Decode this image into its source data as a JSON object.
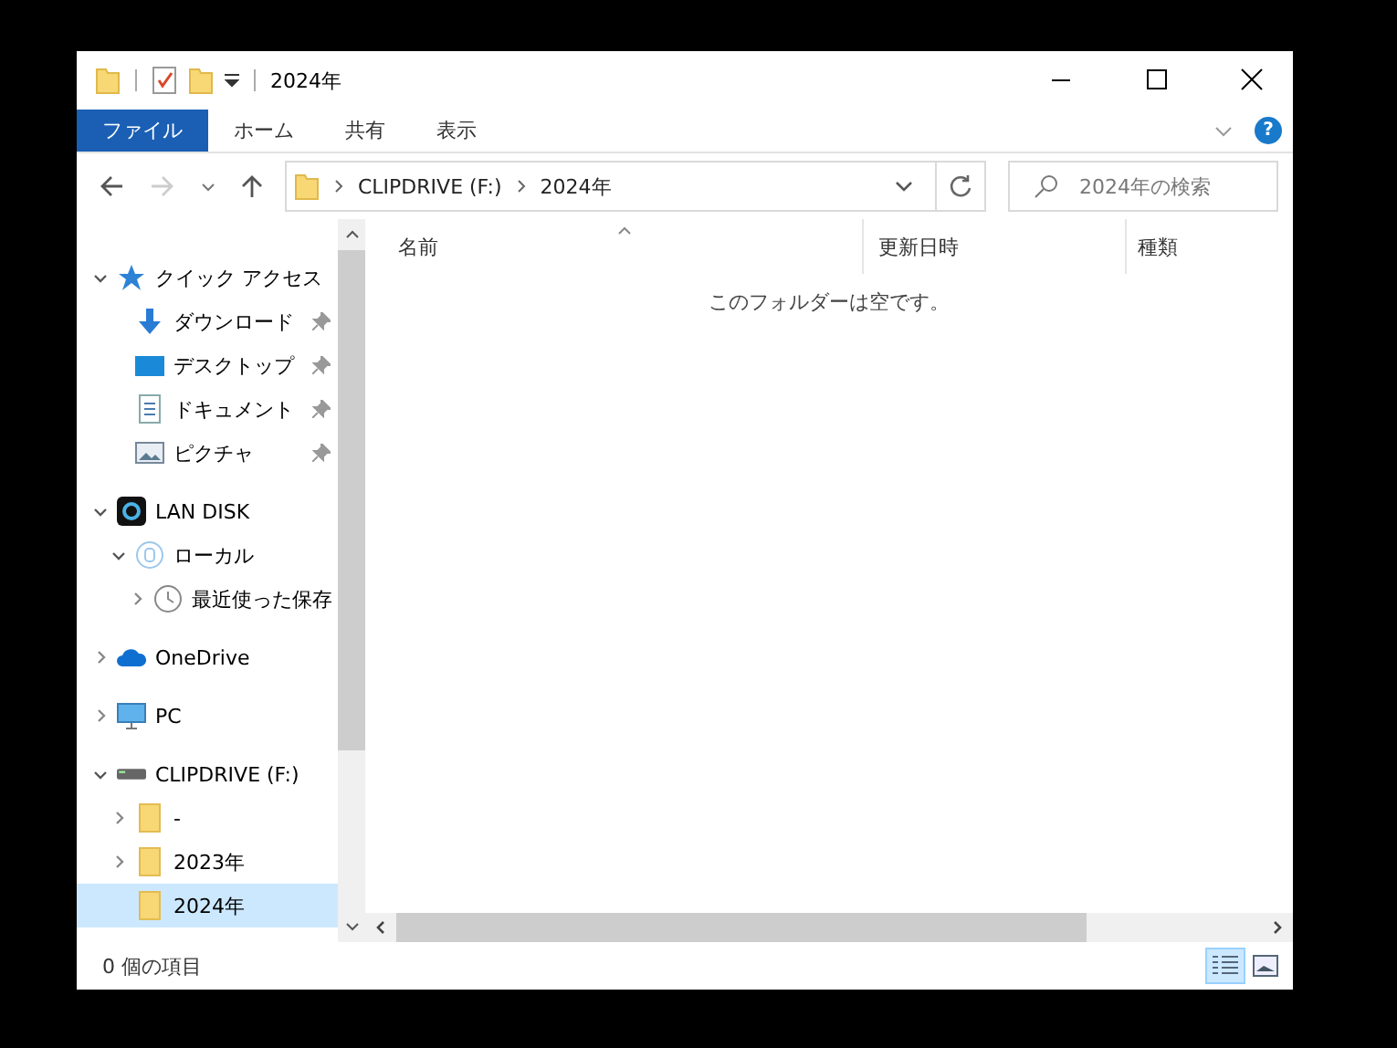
{
  "window": {
    "title": "2024年"
  },
  "ribbon": {
    "tabs": [
      {
        "label": "ファイル",
        "selected": true
      },
      {
        "label": "ホーム",
        "selected": false
      },
      {
        "label": "共有",
        "selected": false
      },
      {
        "label": "表示",
        "selected": false
      }
    ]
  },
  "address": {
    "path": [
      "CLIPDRIVE (F:)",
      "2024年"
    ]
  },
  "search": {
    "placeholder": "2024年の検索"
  },
  "help": {
    "label": "?"
  },
  "sidebar": {
    "items": [
      {
        "label": "クイック アクセス",
        "kind": "star",
        "expanded": true,
        "selected": false,
        "pinned": false,
        "children": [
          {
            "label": "ダウンロード",
            "kind": "download",
            "selected": false,
            "pinned": true
          },
          {
            "label": "デスクトップ",
            "kind": "desktop",
            "selected": false,
            "pinned": true
          },
          {
            "label": "ドキュメント",
            "kind": "document",
            "selected": false,
            "pinned": true
          },
          {
            "label": "ピクチャ",
            "kind": "picture",
            "selected": false,
            "pinned": true
          }
        ]
      },
      {
        "label": "LAN DISK",
        "kind": "nas",
        "expanded": true,
        "selected": false,
        "pinned": false,
        "children": [
          {
            "label": "ローカル",
            "kind": "local",
            "expanded": true,
            "selected": false,
            "pinned": false,
            "children": [
              {
                "label": "最近使った保存",
                "kind": "clock",
                "expanded": false,
                "selected": false,
                "pinned": false
              }
            ]
          }
        ]
      },
      {
        "label": "OneDrive",
        "kind": "cloud",
        "expanded": false,
        "selected": false,
        "pinned": false
      },
      {
        "label": "PC",
        "kind": "pc",
        "expanded": false,
        "selected": false,
        "pinned": false
      },
      {
        "label": "CLIPDRIVE (F:)",
        "kind": "drive",
        "expanded": true,
        "selected": false,
        "pinned": false,
        "children": [
          {
            "label": "-",
            "kind": "folder",
            "expanded": false,
            "selected": false,
            "pinned": false
          },
          {
            "label": "2023年",
            "kind": "folder",
            "expanded": false,
            "selected": false,
            "pinned": false
          },
          {
            "label": "2024年",
            "kind": "folder",
            "selected": true,
            "pinned": false
          }
        ]
      }
    ]
  },
  "table": {
    "columns": [
      "名前",
      "更新日時",
      "種類"
    ],
    "empty_message": "このフォルダーは空です。"
  },
  "status_bar": {
    "count": "0 個の項目"
  }
}
